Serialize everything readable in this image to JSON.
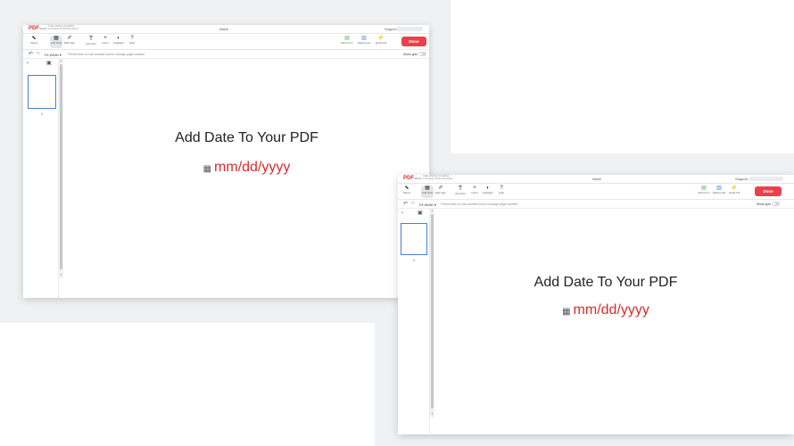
{
  "app": {
    "logo": "PDF",
    "logo_suffix": "Simpli",
    "tagline_line1": "Online Platform for Editing",
    "tagline_line2": "& Creating of PDF Documents",
    "doc_title": "blank",
    "support": "Support"
  },
  "toolbar": {
    "tools": [
      {
        "label": "Select",
        "icon": "cursor-icon"
      },
      {
        "label": "Add Date",
        "icon": "calendar-icon"
      },
      {
        "label": "Edit Sign",
        "icon": "pen-icon"
      },
      {
        "label": "Add Text",
        "icon": "text-icon"
      },
      {
        "label": "Insert",
        "icon": "insert-icon"
      },
      {
        "label": "Highlight",
        "icon": "highlight-icon"
      },
      {
        "label": "Help",
        "icon": "help-icon"
      }
    ],
    "right_tools": [
      {
        "label": "Edit Form",
        "icon": "form-icon"
      },
      {
        "label": "Watermark",
        "icon": "watermark-icon"
      },
      {
        "label": "Quick Fill",
        "icon": "quickfill-icon"
      }
    ],
    "done_label": "Done"
  },
  "subbar": {
    "undo": "↶",
    "redo": "↷",
    "fit_width": "Fit Width",
    "hint": "Fill the form or use another tool to change page content",
    "show_grid": "Show grid"
  },
  "sidebar": {
    "page_number": "1"
  },
  "page": {
    "heading": "Add Date To Your PDF",
    "date_placeholder": "mm/dd/yyyy"
  },
  "colors": {
    "accent": "#e8414d",
    "date_text": "#d62e2e",
    "thumb_border": "#4a7fd1"
  }
}
